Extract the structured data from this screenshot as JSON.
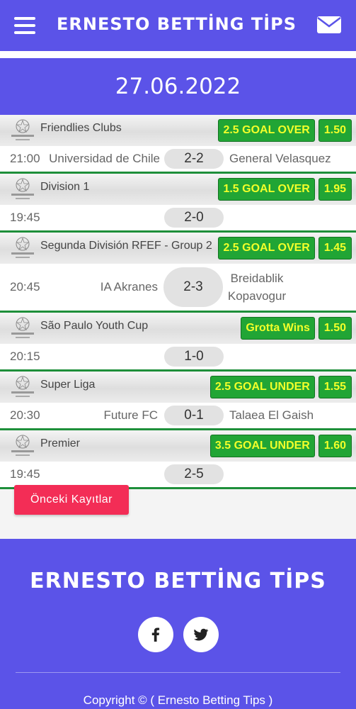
{
  "header": {
    "brand": "ERNESTO BETTİNG TİPS"
  },
  "date": "27.06.2022",
  "matches": [
    {
      "league": "Friendlies Clubs",
      "tip": "2.5 GOAL OVER",
      "odd": "1.50",
      "time": "21:00",
      "home": "Universidad de Chile",
      "score": "2-2",
      "away": "General Velasquez"
    },
    {
      "league": "Division 1",
      "tip": "1.5 GOAL OVER",
      "odd": "1.95",
      "time": "19:45",
      "home": "",
      "score": "2-0",
      "away": ""
    },
    {
      "league": "Segunda División RFEF - Group 2",
      "tip": "2.5 GOAL OVER",
      "odd": "1.45",
      "time": "20:45",
      "home": "IA Akranes",
      "score": "2-3",
      "away_line1": "Breidablik",
      "away_line2": "Kopavogur"
    },
    {
      "league": "São Paulo Youth Cup",
      "tip": "Grotta Wins",
      "odd": "1.50",
      "time": "20:15",
      "home": "",
      "score": "1-0",
      "away": ""
    },
    {
      "league": "Super Liga",
      "tip": "2.5 GOAL UNDER",
      "odd": "1.55",
      "time": "20:30",
      "home": "Future FC",
      "score": "0-1",
      "away": "Talaea El Gaish"
    },
    {
      "league": "Premier",
      "tip": "3.5 GOAL UNDER",
      "odd": "1.60",
      "time": "19:45",
      "home": "",
      "score": "2-5",
      "away": ""
    }
  ],
  "prev_button": "Önceki Kayıtlar",
  "footer": {
    "title": "ERNESTO BETTİNG TİPS",
    "copyright": "Copyright © ( Ernesto Betting Tips )"
  },
  "icons": {
    "menu": "hamburger-icon",
    "mail": "envelope-icon",
    "league": "champions-league-logo",
    "facebook": "facebook-icon",
    "twitter": "twitter-icon"
  },
  "colors": {
    "primary": "#5b53e8",
    "tip_bg": "#21a535",
    "tip_text": "#f2ff2a",
    "prev_button": "#f32d56",
    "separator": "#1e8f3a"
  }
}
